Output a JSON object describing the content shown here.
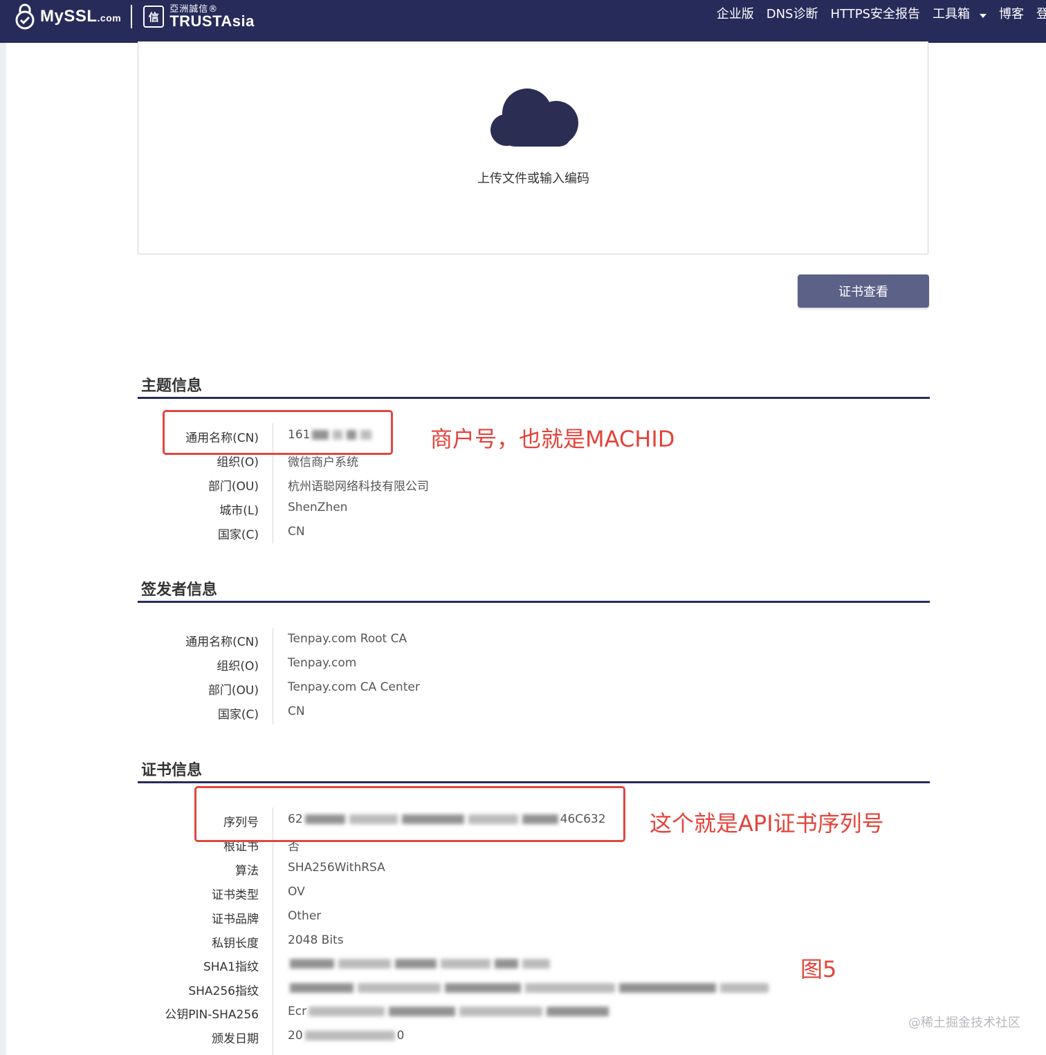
{
  "nav": {
    "logo_mark": "MySSL",
    "logo_suffix": ".com",
    "partner_badge": "信",
    "partner_cn": "亞洲誠信®",
    "partner_en": "TRUSTAsia",
    "items": [
      "企业版",
      "DNS诊断",
      "HTTPS安全报告",
      "工具箱",
      "博客",
      "登"
    ]
  },
  "upload": {
    "label": "上传文件或输入编码"
  },
  "view_button": "证书查看",
  "subject": {
    "title": "主题信息",
    "rows": [
      {
        "label": "通用名称(CN)",
        "value": "161"
      },
      {
        "label": "组织(O)",
        "value": "微信商户系统"
      },
      {
        "label": "部门(OU)",
        "value": "杭州语聪网络科技有限公司"
      },
      {
        "label": "城市(L)",
        "value": "ShenZhen"
      },
      {
        "label": "国家(C)",
        "value": "CN"
      }
    ]
  },
  "issuer": {
    "title": "签发者信息",
    "rows": [
      {
        "label": "通用名称(CN)",
        "value": "Tenpay.com Root CA"
      },
      {
        "label": "组织(O)",
        "value": "Tenpay.com"
      },
      {
        "label": "部门(OU)",
        "value": "Tenpay.com CA Center"
      },
      {
        "label": "国家(C)",
        "value": "CN"
      }
    ]
  },
  "cert": {
    "title": "证书信息",
    "rows": [
      {
        "label": "序列号",
        "value_prefix": "62",
        "value_suffix": "46C632"
      },
      {
        "label": "根证书",
        "value": "否"
      },
      {
        "label": "算法",
        "value": "SHA256WithRSA"
      },
      {
        "label": "证书类型",
        "value": "OV"
      },
      {
        "label": "证书品牌",
        "value": "Other"
      },
      {
        "label": "私钥长度",
        "value": "2048 Bits"
      },
      {
        "label": "SHA1指纹",
        "value": ""
      },
      {
        "label": "SHA256指纹",
        "value": ""
      },
      {
        "label": "公钥PIN-SHA256",
        "value_prefix": "Ecr"
      },
      {
        "label": "颁发日期",
        "value_prefix": "20",
        "value_suffix": "0"
      }
    ]
  },
  "annotations": {
    "merchant": "商户号，也就是MACHID",
    "serial": "这个就是API证书序列号",
    "figure": "图5"
  },
  "watermark": "@稀土掘金技术社区",
  "colors": {
    "nav_bg": "#272b5a",
    "button_bg": "#5c6188",
    "annotation_red": "#e1463f"
  }
}
